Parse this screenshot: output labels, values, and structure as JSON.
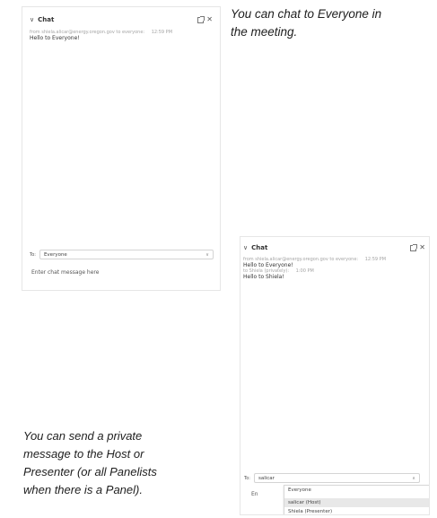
{
  "panel_a": {
    "title": "Chat",
    "messages": [
      {
        "meta": "from shiela.alicar@energy.oregon.gov to everyone:",
        "time": "12:59 PM",
        "text": "Hello to Everyone!"
      }
    ],
    "to_label": "To:",
    "to_value": "Everyone",
    "input_placeholder": "Enter chat message here"
  },
  "panel_b": {
    "title": "Chat",
    "messages": [
      {
        "meta": "from shiela.alicar@energy.oregon.gov to everyone:",
        "time": "12:59 PM",
        "text": "Hello to Everyone!"
      },
      {
        "meta": "to Shiela (privately):",
        "time": "1:00 PM",
        "text": "Hello to Shiela!"
      }
    ],
    "to_label": "To:",
    "to_value": "salicar",
    "input_stub": "En",
    "dropdown_options": [
      "Everyone",
      "salicar (Host)",
      "Shiela (Presenter)"
    ]
  },
  "captions": {
    "top_lines": [
      "You can chat to Everyone in",
      "the meeting."
    ],
    "bottom_lines": [
      "You can send a private",
      "message to the Host or",
      "Presenter (or all Panelists",
      "when there is a Panel)."
    ]
  },
  "icons": [
    "chevron-down-icon",
    "popout-icon",
    "close-icon",
    "caret-icon"
  ]
}
